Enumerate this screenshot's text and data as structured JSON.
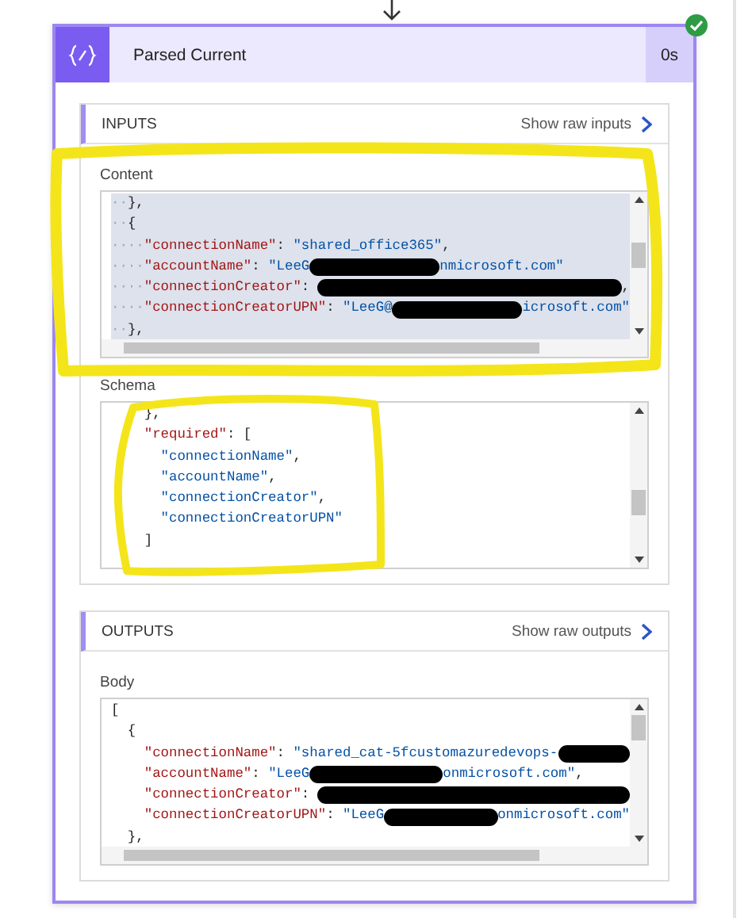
{
  "card": {
    "title": "Parsed Current",
    "duration": "0s"
  },
  "sections": [
    {
      "heading": "INPUTS",
      "raw_link": "Show raw inputs",
      "fields": [
        {
          "label": "Content",
          "horizontal_scroll": true,
          "lines": [
            {
              "selected": true,
              "tokens": [
                {
                  "kind": "indent",
                  "text": "··"
                },
                {
                  "kind": "punct",
                  "text": "},"
                }
              ]
            },
            {
              "selected": true,
              "tokens": [
                {
                  "kind": "indent",
                  "text": "··"
                },
                {
                  "kind": "punct",
                  "text": "{"
                }
              ]
            },
            {
              "selected": true,
              "tokens": [
                {
                  "kind": "indent",
                  "text": "····"
                },
                {
                  "kind": "key",
                  "text": "\"connectionName\""
                },
                {
                  "kind": "punct",
                  "text": ": "
                },
                {
                  "kind": "string",
                  "text": "\"shared_office365\""
                },
                {
                  "kind": "punct",
                  "text": ","
                }
              ]
            },
            {
              "selected": true,
              "tokens": [
                {
                  "kind": "indent",
                  "text": "····"
                },
                {
                  "kind": "key",
                  "text": "\"accountName\""
                },
                {
                  "kind": "punct",
                  "text": ": "
                },
                {
                  "kind": "string",
                  "text": "\"LeeG"
                },
                {
                  "kind": "redacted"
                },
                {
                  "kind": "string",
                  "text": "nmicrosoft.com\""
                }
              ]
            },
            {
              "selected": true,
              "tokens": [
                {
                  "kind": "indent",
                  "text": "····"
                },
                {
                  "kind": "key",
                  "text": "\"connectionCreator\""
                },
                {
                  "kind": "punct",
                  "text": ": "
                },
                {
                  "kind": "redacted"
                },
                {
                  "kind": "punct",
                  "text": ","
                }
              ]
            },
            {
              "selected": true,
              "tokens": [
                {
                  "kind": "indent",
                  "text": "····"
                },
                {
                  "kind": "key",
                  "text": "\"connectionCreatorUPN\""
                },
                {
                  "kind": "punct",
                  "text": ": "
                },
                {
                  "kind": "string",
                  "text": "\"LeeG@"
                },
                {
                  "kind": "redacted"
                },
                {
                  "kind": "string",
                  "text": "icrosoft.com\""
                }
              ]
            },
            {
              "selected": true,
              "tokens": [
                {
                  "kind": "indent",
                  "text": "··"
                },
                {
                  "kind": "punct",
                  "text": "},"
                }
              ]
            }
          ]
        },
        {
          "label": "Schema",
          "horizontal_scroll": false,
          "lines": [
            {
              "selected": false,
              "tokens": [
                {
                  "kind": "punct",
                  "text": "    },"
                }
              ]
            },
            {
              "selected": false,
              "tokens": [
                {
                  "kind": "key",
                  "text": "    \"required\""
                },
                {
                  "kind": "punct",
                  "text": ": ["
                }
              ]
            },
            {
              "selected": false,
              "tokens": [
                {
                  "kind": "string",
                  "text": "      \"connectionName\""
                },
                {
                  "kind": "punct",
                  "text": ","
                }
              ]
            },
            {
              "selected": false,
              "tokens": [
                {
                  "kind": "string",
                  "text": "      \"accountName\""
                },
                {
                  "kind": "punct",
                  "text": ","
                }
              ]
            },
            {
              "selected": false,
              "tokens": [
                {
                  "kind": "string",
                  "text": "      \"connectionCreator\""
                },
                {
                  "kind": "punct",
                  "text": ","
                }
              ]
            },
            {
              "selected": false,
              "tokens": [
                {
                  "kind": "string",
                  "text": "      \"connectionCreatorUPN\""
                }
              ]
            },
            {
              "selected": false,
              "tokens": [
                {
                  "kind": "punct",
                  "text": "    ]"
                }
              ]
            }
          ]
        }
      ]
    },
    {
      "heading": "OUTPUTS",
      "raw_link": "Show raw outputs",
      "fields": [
        {
          "label": "Body",
          "horizontal_scroll": true,
          "lines": [
            {
              "selected": false,
              "tokens": [
                {
                  "kind": "punct",
                  "text": "["
                }
              ]
            },
            {
              "selected": false,
              "tokens": [
                {
                  "kind": "punct",
                  "text": "  {"
                }
              ]
            },
            {
              "selected": false,
              "tokens": [
                {
                  "kind": "key",
                  "text": "    \"connectionName\""
                },
                {
                  "kind": "punct",
                  "text": ": "
                },
                {
                  "kind": "string",
                  "text": "\"shared_cat-5fcustomazuredevops-"
                },
                {
                  "kind": "redacted"
                }
              ]
            },
            {
              "selected": false,
              "tokens": [
                {
                  "kind": "key",
                  "text": "    \"accountName\""
                },
                {
                  "kind": "punct",
                  "text": ": "
                },
                {
                  "kind": "string",
                  "text": "\"LeeG"
                },
                {
                  "kind": "redacted"
                },
                {
                  "kind": "string",
                  "text": "onmicrosoft.com\""
                },
                {
                  "kind": "punct",
                  "text": ","
                }
              ]
            },
            {
              "selected": false,
              "tokens": [
                {
                  "kind": "key",
                  "text": "    \"connectionCreator\""
                },
                {
                  "kind": "punct",
                  "text": ": "
                },
                {
                  "kind": "redacted"
                }
              ]
            },
            {
              "selected": false,
              "tokens": [
                {
                  "kind": "key",
                  "text": "    \"connectionCreatorUPN\""
                },
                {
                  "kind": "punct",
                  "text": ": "
                },
                {
                  "kind": "string",
                  "text": "\"LeeG"
                },
                {
                  "kind": "redacted"
                },
                {
                  "kind": "string",
                  "text": "onmicrosoft.com\""
                }
              ]
            },
            {
              "selected": false,
              "tokens": [
                {
                  "kind": "punct",
                  "text": "  },"
                }
              ]
            }
          ]
        }
      ]
    }
  ],
  "annotations": [
    {
      "kind": "box"
    },
    {
      "kind": "lasso"
    }
  ]
}
